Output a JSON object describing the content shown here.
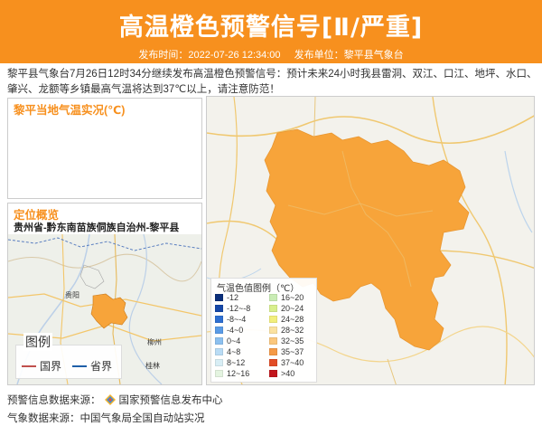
{
  "header": {
    "title": "高温橙色预警信号[Ⅱ/严重]",
    "publish_time_label": "发布时间：2022-07-26 12:34:00",
    "publisher_label": "发布单位：黎平县气象台",
    "bg_color": "#f7901e"
  },
  "description": "黎平县气象台7月26日12时34分继续发布高温橙色预警信号：预计未来24小时我县雷洞、双江、口江、地坪、水口、肇兴、龙额等乡镇最高气温将达到37℃以上，请注意防范！",
  "panels": {
    "realtime_title": "黎平当地气温实况(℃)",
    "location_title": "定位概览",
    "location_subtitle": "贵州省-黔东南苗族侗族自治州-黎平县",
    "location_legend": {
      "title": "图例",
      "items": [
        {
          "label": "国界",
          "color": "#c0504d"
        },
        {
          "label": "省界",
          "color": "#1f5fa8"
        }
      ]
    }
  },
  "temp_legend": {
    "title": "气温色值图例（℃）",
    "items": [
      {
        "label": "-12",
        "color": "#0b2f7a"
      },
      {
        "label": "-12~-8",
        "color": "#1648a8"
      },
      {
        "label": "-8~-4",
        "color": "#2e6fd1"
      },
      {
        "label": "-4~0",
        "color": "#5a9be6"
      },
      {
        "label": "0~4",
        "color": "#8cc0ef"
      },
      {
        "label": "4~8",
        "color": "#b9dcf5"
      },
      {
        "label": "8~12",
        "color": "#d8eef5"
      },
      {
        "label": "12~16",
        "color": "#e4f4e0"
      },
      {
        "label": "16~20",
        "color": "#c9ecb4"
      },
      {
        "label": "20~24",
        "color": "#d8ef8c"
      },
      {
        "label": "24~28",
        "color": "#f2ef7c"
      },
      {
        "label": "28~32",
        "color": "#fbe2a0"
      },
      {
        "label": "32~35",
        "color": "#fbc77c"
      },
      {
        "label": "35~37",
        "color": "#f59a46"
      },
      {
        "label": "37~40",
        "color": "#e24c26"
      },
      {
        "label": ">40",
        "color": "#c2161c"
      }
    ]
  },
  "map": {
    "area_color": "#f7a43a",
    "location_labels": [
      "贵阳",
      "柳州",
      "桂林"
    ]
  },
  "sources": {
    "warning_label": "预警信息数据来源：",
    "warning_value": "国家预警信息发布中心",
    "weather_label": "气象数据来源：",
    "weather_value": "中国气象局全国自动站实况"
  }
}
